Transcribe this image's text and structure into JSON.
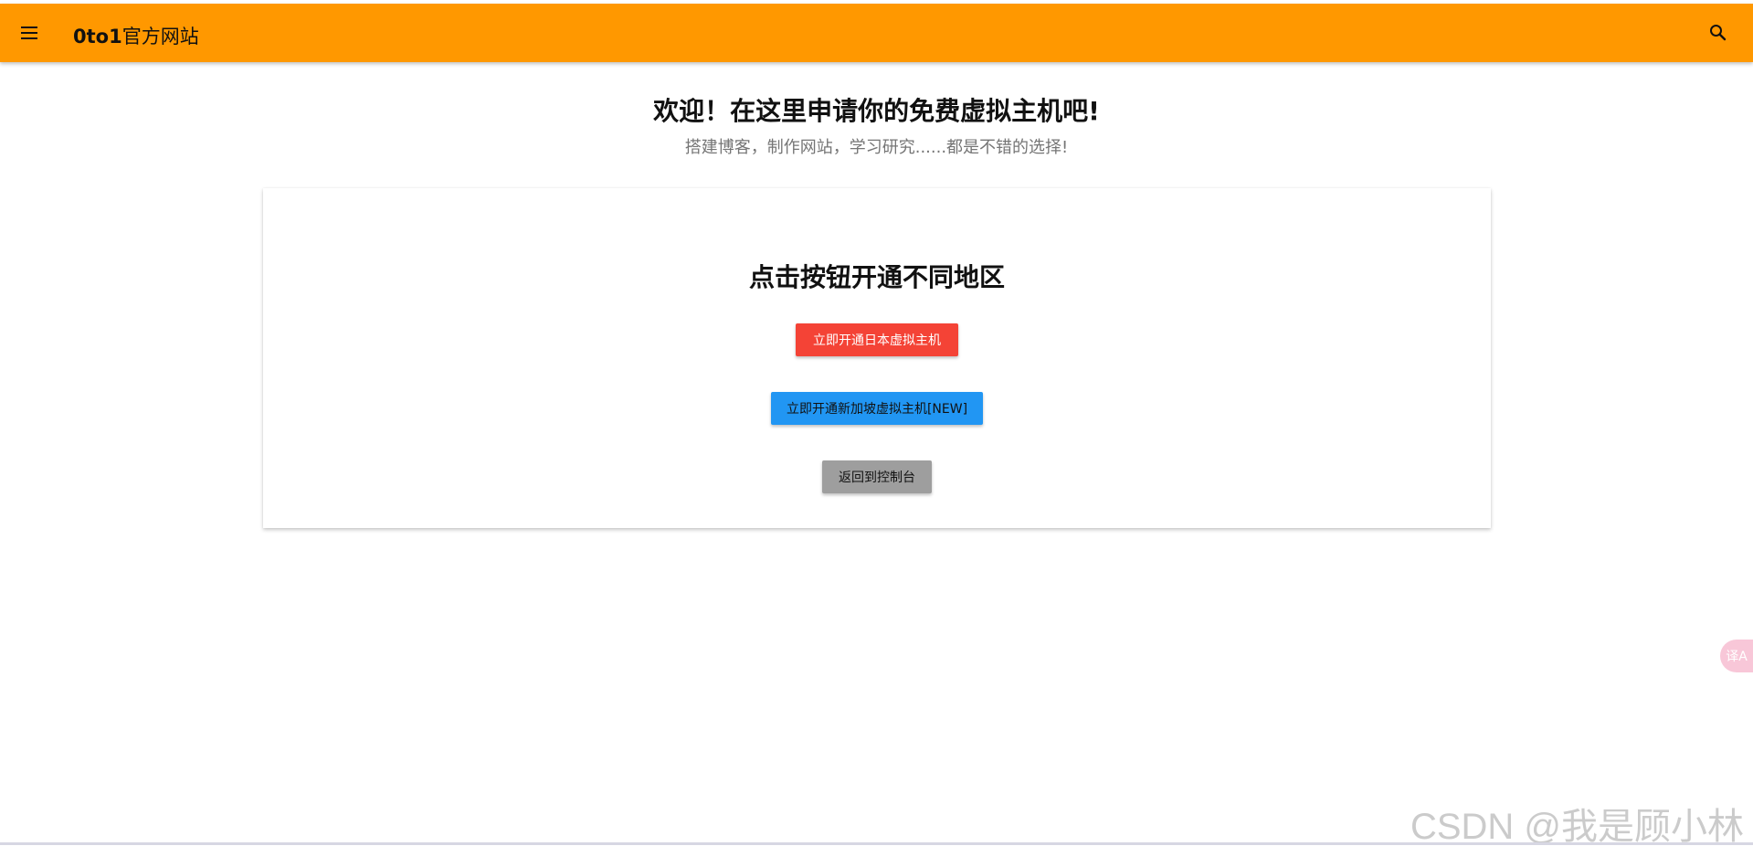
{
  "header": {
    "brand_bold": "0to1",
    "brand_rest": "官方网站",
    "menu_icon": "menu-icon",
    "search_icon": "search-icon",
    "bg_color": "#ff9800"
  },
  "hero": {
    "title_part1": "欢迎！在",
    "title_bold1": "这里",
    "title_part2": "申请你的",
    "title_bold2": "免费",
    "title_part3": "虚拟主机吧!",
    "subtitle": "搭建博客，制作网站，学习研究......都是不错的选择!"
  },
  "card": {
    "title": "点击按钮开通不同地区",
    "buttons": {
      "japan": "立即开通日本虚拟主机",
      "singapore": "立即开通新加坡虚拟主机[NEW]",
      "back": "返回到控制台"
    }
  },
  "colors": {
    "japan_button": "#f44336",
    "singapore_button": "#2196f3",
    "back_button": "#9e9e9e"
  },
  "floating": {
    "translate_icon": "translate-icon",
    "translate_glyph": "译A"
  },
  "watermark": "CSDN @我是顾小林"
}
